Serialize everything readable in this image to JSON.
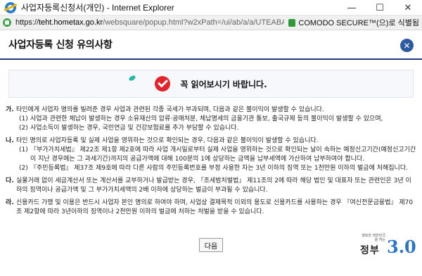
{
  "window": {
    "title": "사업자등록신청서(개인) - Internet Explorer",
    "minimize_glyph": "—",
    "maximize_glyph": "☐",
    "close_glyph": "✕"
  },
  "address": {
    "url_scheme": "https://",
    "url_domain": "teht.hometax.go.kr",
    "url_rest": "/websquare/popup.html?w2xPath=/ui/ab/a/a/UTEABAAA40.xml&popupID=U",
    "cert_label": "COMODO SECURE™(으)로 식별됨"
  },
  "popup": {
    "title": "사업자등록 신청 유의사항",
    "close_glyph": "✕"
  },
  "notice": {
    "text": "꼭 읽어보시기 바랍니다."
  },
  "rules": [
    {
      "marker": "가.",
      "text": "타인에게 사업자 명의를 빌려준 경우 사업과 관련된 각종 국세가 부과되며, 다음과 같은 불이익이 발생할 수 있습니다.",
      "subs": [
        {
          "num": "(1)",
          "text": "사업과 관련한 체납이 발생하는 경우 소유재산의 압류·공매처분, 체납명세의 금융기관 통보, 출국규제 등의 불이익이 발생할 수 있으며,"
        },
        {
          "num": "(2)",
          "text": "사업소득이 발생하는 경우, 국민연금 및 건강보험료를 추가 부담할 수 있습니다."
        }
      ]
    },
    {
      "marker": "나.",
      "text": "타인 명의로 사업자등록 및 실제 사업을 영위하는 것으로 확인되는 경우, 다음과 같은 불이익이 발생할 수 있습니다.",
      "subs": [
        {
          "num": "(1)",
          "text": "『부가가치세법』 제22조 제1항 제2호에 따라 사업 개시일로부터 실제 사업을 영위하는 것으로 확인되는 날이 속하는 예정신고기간(예정신고기간이 지난 경우에는 그 과세기간)까지의 공급가액에 대해 100분의 1에 상당하는 금액을 납부세액에 가산하여 납부하여야 합니다."
        },
        {
          "num": "(2)",
          "text": "『주민등록법』 제37조 제9호에 따라 다른 사람의 주민등록번호를 부정 사용한 자는 3년 이하의 징역 또는 1천만원 이하의 벌금에 처해집니다."
        }
      ]
    },
    {
      "marker": "다.",
      "text": "실물거래 없이 세금계산서 또는 계산서를 교부하거나 발급받는 경우, 『조세범처벌법』 제11조의 2에 따라 해당 법인 및 대표자 또는 관련인은 3년 이하의 징역이나 공급가액 및 그 부가가치세액의 2배 이하에 상당하는 벌금이 부과될 수 있습니다.",
      "subs": []
    },
    {
      "marker": "라.",
      "text": "신용카드 가맹 및 이용은 반드시 사업자 본인 명의로 하여야 하며, 사업상 결제목적 이외의 용도로 신용카드를 사용하는 경우 『여신전문금융법』 제70조 제2항에 따라 3년이하의 징역이나 2천만원 이하의 벌금에 처하는 처벌을 받을 수 있습니다.",
      "subs": []
    }
  ],
  "buttons": {
    "next_label": "다음"
  },
  "logo": {
    "slogan": "행복한 대한민국을 여는",
    "name": "정부",
    "version": "3.0"
  }
}
